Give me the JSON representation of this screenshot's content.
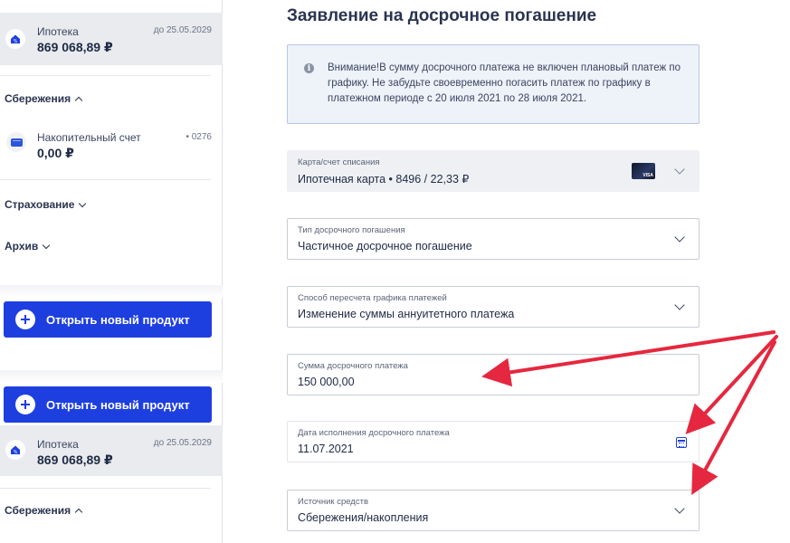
{
  "sidebar": {
    "mortgage_top": {
      "name": "Ипотека",
      "amount": "869 068,89 ₽",
      "date": "до 25.05.2029"
    },
    "savings_header": "Сбережения",
    "savings_account": {
      "name": "Накопительный счет",
      "amount": "0,00 ₽",
      "number": "• 0276"
    },
    "insurance_header": "Страхование",
    "archive_header": "Архив",
    "open_product_label": "Открыть новый продукт",
    "open_product_label_2": "Открыть новый продукт",
    "mortgage_bottom": {
      "name": "Ипотека",
      "amount": "869 068,89 ₽",
      "date": "до 25.05.2029"
    },
    "savings_header_2": "Сбережения"
  },
  "main": {
    "title": "Заявление на досрочное погашение",
    "notice": "Внимание!В сумму досрочного платежа не включен плановый платеж по графику. Не забудьте своевременно погасить платеж по графику в платежном периоде с 20 июля 2021 по 28 июля 2021.",
    "fields": {
      "card": {
        "label": "Карта/счет списания",
        "value": "Ипотечная карта • 8496 / 22,33 ₽",
        "card_brand": "VISA"
      },
      "type": {
        "label": "Тип досрочного погашения",
        "value": "Частичное досрочное погашение"
      },
      "method": {
        "label": "Способ пересчета графика платежей",
        "value": "Изменение суммы аннуитетного платежа"
      },
      "amount": {
        "label": "Сумма досрочного платежа",
        "value": "150 000,00"
      },
      "date": {
        "label": "Дата исполнения досрочного платежа",
        "value": "11.07.2021"
      },
      "source": {
        "label": "Источник средств",
        "value": "Сбережения/накопления"
      }
    }
  },
  "colors": {
    "accent": "#1e3fe0",
    "annotation_arrow": "#e5283f",
    "notice_bg": "#eef2f9"
  }
}
